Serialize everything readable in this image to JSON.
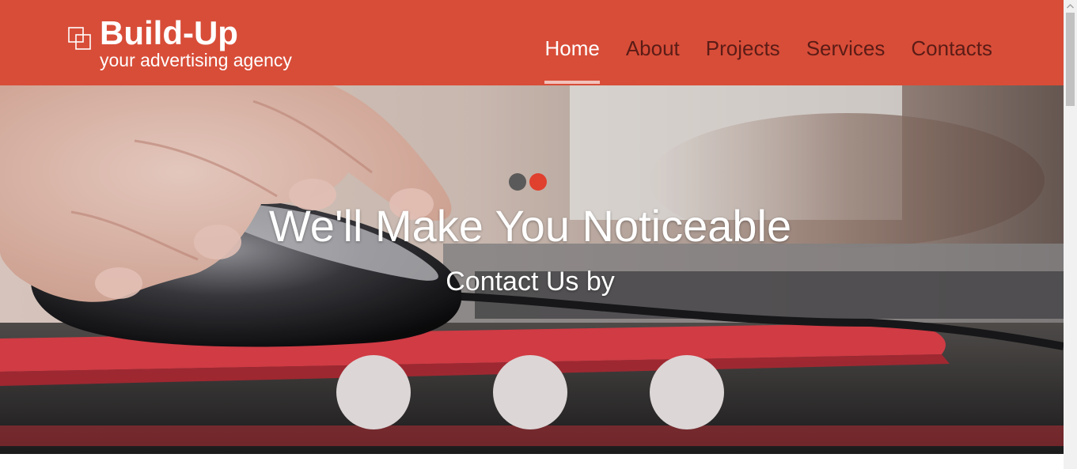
{
  "brand": {
    "title": "Build-Up",
    "tagline": "your advertising agency"
  },
  "nav": {
    "items": [
      {
        "label": "Home",
        "active": true
      },
      {
        "label": "About",
        "active": false
      },
      {
        "label": "Projects",
        "active": false
      },
      {
        "label": "Services",
        "active": false
      },
      {
        "label": "Contacts",
        "active": false
      }
    ]
  },
  "hero": {
    "heading": "We'll Make You Noticeable",
    "subheading": "Contact Us by",
    "slides_total": 2,
    "active_slide": 2,
    "contact_buttons_count": 3
  },
  "colors": {
    "header_bg": "#d84d38",
    "nav_text": "#5b1c16",
    "nav_active_text": "#ffffff",
    "nav_active_underline": "#f2c2bb",
    "dot_inactive": "#5a5a5a",
    "dot_active": "#e0402e",
    "contact_circle": "#dcd6d6"
  },
  "icons": {
    "logo": "overlapping-squares-icon",
    "scroll_up": "chevron-up-icon"
  }
}
